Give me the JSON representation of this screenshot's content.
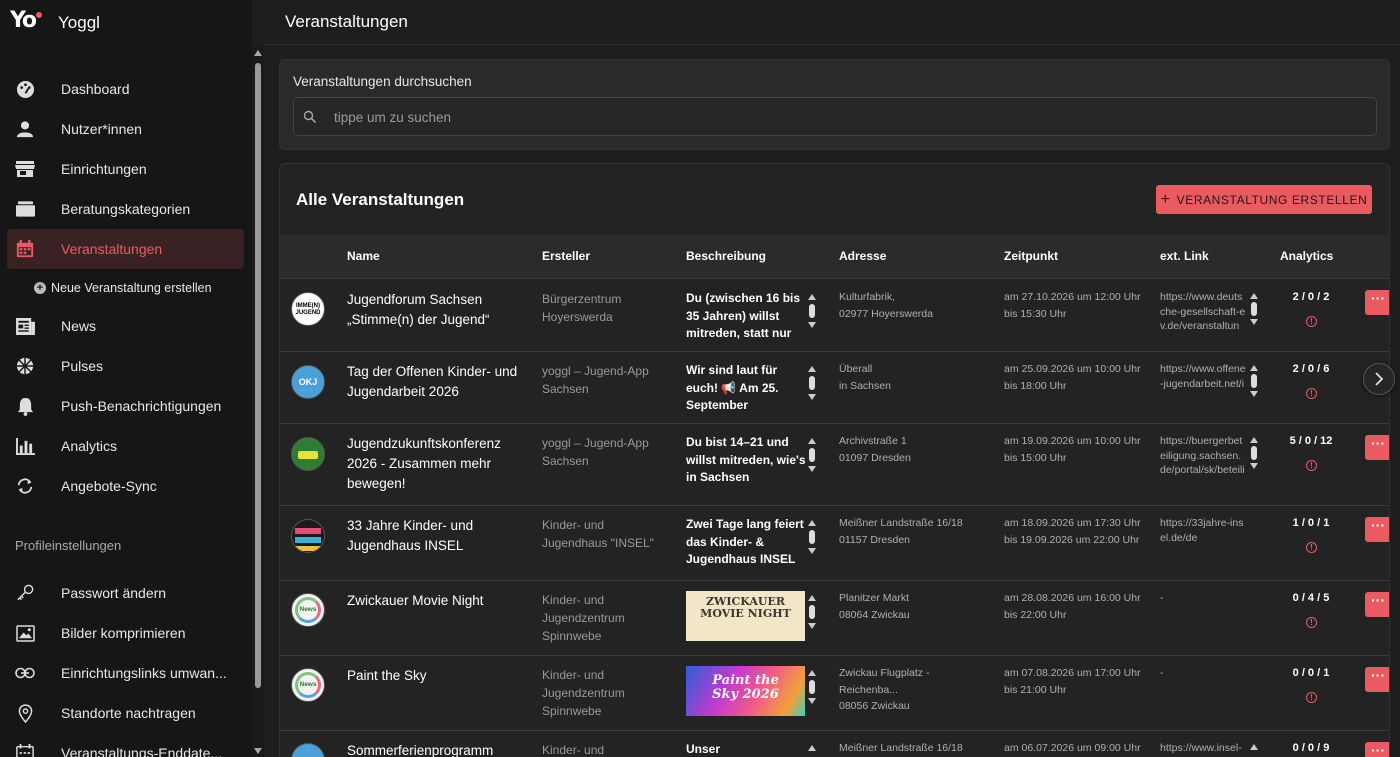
{
  "app": {
    "name": "Yoggl",
    "logo_text": "Yo"
  },
  "page_title": "Veranstaltungen",
  "sidebar": {
    "items": [
      {
        "label": "Dashboard",
        "icon": "dashboard-icon"
      },
      {
        "label": "Nutzer*innen",
        "icon": "user-icon"
      },
      {
        "label": "Einrichtungen",
        "icon": "store-icon"
      },
      {
        "label": "Beratungskategorien",
        "icon": "folder-icon"
      },
      {
        "label": "Veranstaltungen",
        "icon": "calendar-icon",
        "active": true
      },
      {
        "label": "News",
        "icon": "news-icon"
      },
      {
        "label": "Pulses",
        "icon": "pulses-icon"
      },
      {
        "label": "Push-Benachrichtigungen",
        "icon": "bell-icon"
      },
      {
        "label": "Analytics",
        "icon": "analytics-icon"
      },
      {
        "label": "Angebote-Sync",
        "icon": "sync-icon"
      }
    ],
    "sub_item": "Neue Veranstaltung erstellen",
    "section_title": "Profileinstellungen",
    "profile_items": [
      {
        "label": "Passwort ändern",
        "icon": "key-icon"
      },
      {
        "label": "Bilder komprimieren",
        "icon": "image-icon"
      },
      {
        "label": "Einrichtungslinks umwan...",
        "icon": "link-icon"
      },
      {
        "label": "Standorte nachtragen",
        "icon": "location-icon"
      },
      {
        "label": "Veranstaltungs-Enddate...",
        "icon": "calendar-icon"
      }
    ]
  },
  "search": {
    "label": "Veranstaltungen durchsuchen",
    "placeholder": "tippe um zu suchen",
    "value": ""
  },
  "events": {
    "title": "Alle Veranstaltungen",
    "create_button": "VERANSTALTUNG ERSTELLEN",
    "columns": [
      "Name",
      "Ersteller",
      "Beschreibung",
      "Adresse",
      "Zeitpunkt",
      "ext. Link",
      "Analytics"
    ],
    "rows": [
      {
        "avatar_text": "IMME(N) JUGEND",
        "name": "Jugendforum Sachsen „Stimme(n) der Jugend“",
        "creator": "Bürgerzentrum Hoyerswerda",
        "description": "Du (zwischen 16 bis 35 Jahren) willst mitreden, statt nur",
        "address_1": "Kulturfabrik,",
        "address_2": "02977 Hoyerswerda",
        "time_1": "am 27.10.2026 um 12:00 Uhr",
        "time_2": "bis 15:30 Uhr",
        "link": "https://www.deutsche-gesellschaft-ev.de/veranstaltun",
        "analytics": "2 / 0 / 2"
      },
      {
        "avatar_text": "OKJ",
        "name": "Tag der Offenen Kinder- und Jugendarbeit 2026",
        "creator": "yoggl – Jugend-App Sachsen",
        "description": "Wir sind laut für euch! 📢 Am 25. September",
        "address_1": "Überall",
        "address_2": "in Sachsen",
        "time_1": "am 25.09.2026 um 10:00 Uhr",
        "time_2": "bis 18:00 Uhr",
        "link": "https://www.offene-jugendarbeit.net/i",
        "analytics": "2 / 0 / 6"
      },
      {
        "avatar_text": "",
        "name": "Jugendzukunftskonferenz 2026 - Zusammen mehr bewegen!",
        "creator": "yoggl – Jugend-App Sachsen",
        "description": "Du bist 14–21 und willst mitreden, wie's in Sachsen",
        "address_1": "Archivstraße 1",
        "address_2": "01097 Dresden",
        "time_1": "am 19.09.2026 um 10:00 Uhr",
        "time_2": "bis 15:00 Uhr",
        "link": "https://buergerbeteiligung.sachsen.de/portal/sk/beteili",
        "analytics": "5 / 0 / 12"
      },
      {
        "avatar_text": "",
        "name": "33 Jahre Kinder- und Jugendhaus INSEL",
        "creator": "Kinder- und Jugendhaus \"INSEL\"",
        "description": "Zwei Tage lang feiert das Kinder- & Jugendhaus INSEL mit",
        "address_1": "Meißner Landstraße 16/18",
        "address_2": "01157 Dresden",
        "time_1": "am 18.09.2026 um 17:30 Uhr",
        "time_2": "bis 19.09.2026 um 22:00 Uhr",
        "link": "https://33jahre-insel.de/de",
        "analytics": "1 / 0 / 1"
      },
      {
        "avatar_text": "News",
        "name": "Zwickauer Movie Night",
        "creator": "Kinder- und Jugendzentrum Spinnwebe",
        "description_image_text": "ZWICKAUER MOVIE NIGHT",
        "address_1": "Planitzer Markt",
        "address_2": "08064 Zwickau",
        "time_1": "am 28.08.2026 um 16:00 Uhr",
        "time_2": "bis 22:00 Uhr",
        "link": "-",
        "analytics": "0 / 4 / 5"
      },
      {
        "avatar_text": "News",
        "name": "Paint the Sky",
        "creator": "Kinder- und Jugendzentrum Spinnwebe",
        "description_image_text": "Paint the Sky 2026",
        "address_1": "Zwickau Flugplatz - Reichenba...",
        "address_2": "08056 Zwickau",
        "time_1": "am 07.08.2026 um 17:00 Uhr",
        "time_2": "bis 21:00 Uhr",
        "link": "-",
        "analytics": "0 / 0 / 1"
      },
      {
        "avatar_text": "",
        "name": "Sommerferienprogramm",
        "creator": "Kinder- und",
        "description": "Unser",
        "address_1": "Meißner Landstraße 16/18",
        "address_2": "",
        "time_1": "am 06.07.2026 um 09:00 Uhr",
        "time_2": "",
        "link": "https://www.insel-",
        "analytics": "0 / 0 / 9"
      }
    ]
  },
  "more_button": "···",
  "colors": {
    "accent": "#e95b60",
    "sidebar_bg": "#161616",
    "card_bg": "#232323"
  }
}
